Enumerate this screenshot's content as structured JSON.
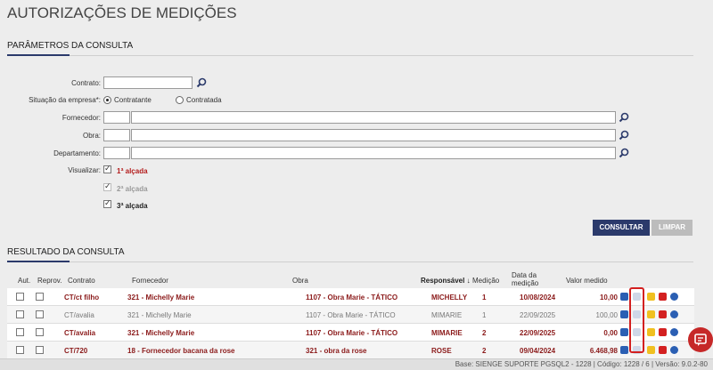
{
  "page_title": "AUTORIZAÇÕES DE MEDIÇÕES",
  "params": {
    "title": "PARÂMETROS DA CONSULTA",
    "contrato_label": "Contrato:",
    "situacao_label": "Situação da empresa*:",
    "situacao_options": [
      "Contratante",
      "Contratada"
    ],
    "situacao_selected": "Contratante",
    "fornecedor_label": "Fornecedor:",
    "obra_label": "Obra:",
    "departamento_label": "Departamento:",
    "visualizar_label": "Visualizar:",
    "alcadas": [
      {
        "label": "1ª alçada",
        "checked": true,
        "enabled": true,
        "color": "#b31b1b"
      },
      {
        "label": "2ª alçada",
        "checked": true,
        "enabled": false,
        "color": "#999999"
      },
      {
        "label": "3ª alçada",
        "checked": true,
        "enabled": true,
        "color": "#222222"
      }
    ],
    "consultar_label": "CONSULTAR",
    "limpar_label": "LIMPAR"
  },
  "results": {
    "title": "RESULTADO DA CONSULTA",
    "columns": {
      "aut": "Aut.",
      "reprov": "Reprov.",
      "contrato": "Contrato",
      "fornecedor": "Fornecedor",
      "obra": "Obra",
      "responsavel": "Responsável",
      "medicao": "Medição",
      "data": "Data da medição",
      "valor": "Valor medido"
    },
    "rows": [
      {
        "contrato": "CT/ct filho",
        "fornecedor": "321 - Michelly Marie",
        "obra": "1107 - Obra Marie - TÁTICO",
        "responsavel": "MICHELLY",
        "medicao": "1",
        "data": "10/08/2024",
        "valor": "10,00",
        "style": "red"
      },
      {
        "contrato": "CT/avalia",
        "fornecedor": "321 - Michelly Marie",
        "obra": "1107 - Obra Marie - TÁTICO",
        "responsavel": "MIMARIE",
        "medicao": "1",
        "data": "22/09/2025",
        "valor": "100,00",
        "style": "gray"
      },
      {
        "contrato": "CT/avalia",
        "fornecedor": "321 - Michelly Marie",
        "obra": "1107 - Obra Marie - TÁTICO",
        "responsavel": "MIMARIE",
        "medicao": "2",
        "data": "22/09/2025",
        "valor": "0,00",
        "style": "red"
      },
      {
        "contrato": "CT/720",
        "fornecedor": "18 - Fornecedor bacana da rose",
        "obra": "321 - obra da rose",
        "responsavel": "ROSE",
        "medicao": "2",
        "data": "09/04/2024",
        "valor": "6.468,98",
        "style": "red"
      }
    ]
  },
  "status_bar": "Base: SIENGE SUPORTE PGSQL2 - 1228 | Código: 1228 / 6 | Versão: 9.0.2-80",
  "colors": {
    "accent": "#2b3a6b",
    "brand_red": "#c62828"
  }
}
